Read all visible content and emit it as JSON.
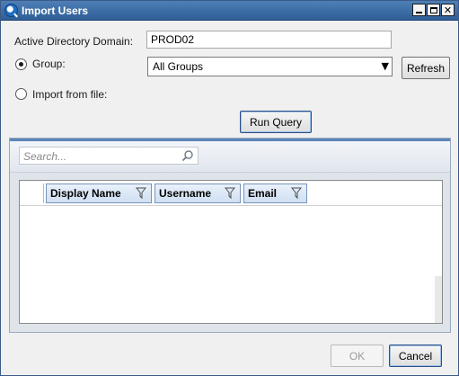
{
  "window": {
    "title": "Import Users",
    "icon": "app-q-icon",
    "controls": {
      "minimize": "minimize-icon",
      "maximize": "maximize-icon",
      "close": "✕"
    }
  },
  "form": {
    "domain_label": "Active Directory Domain:",
    "domain_value": "PROD02",
    "group_label": "Group:",
    "group_selected": true,
    "group_value": "All Groups",
    "refresh_label": "Refresh",
    "import_file_label": "Import from file:",
    "import_file_selected": false,
    "run_query_label": "Run Query"
  },
  "results": {
    "search_placeholder": "Search...",
    "columns": [
      {
        "label": "Display Name"
      },
      {
        "label": "Username"
      },
      {
        "label": "Email"
      }
    ],
    "rows": []
  },
  "footer": {
    "ok_label": "OK",
    "ok_enabled": false,
    "cancel_label": "Cancel"
  },
  "colors": {
    "titlebar": "#2f5e97",
    "header_accent": "#5b86b8",
    "column_header": "#cfdff2"
  }
}
